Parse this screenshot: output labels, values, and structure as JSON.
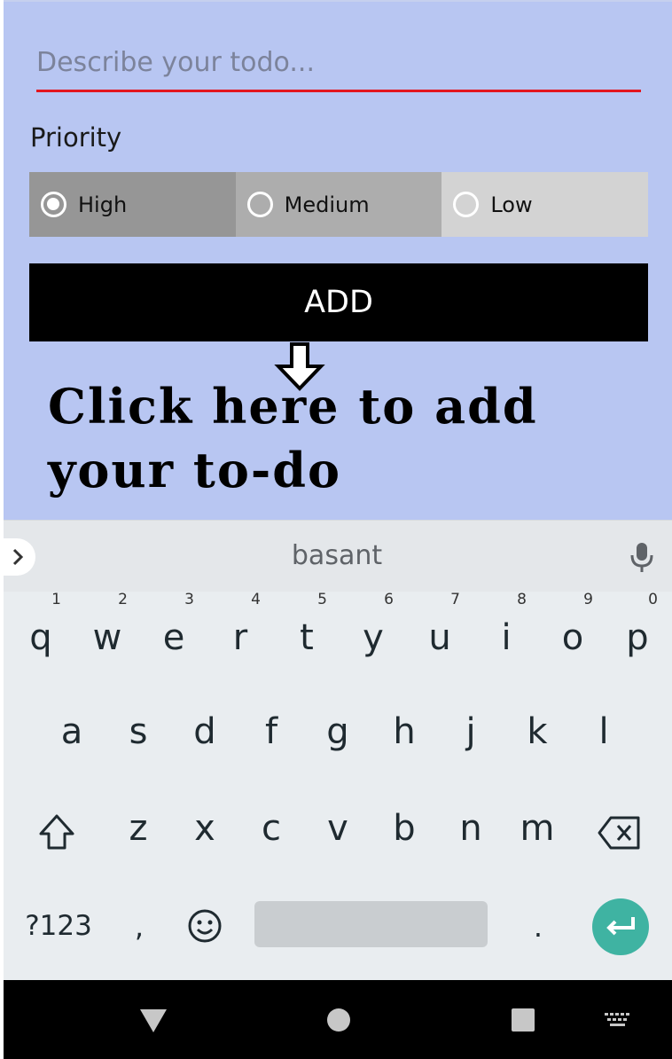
{
  "form": {
    "placeholder": "Describe your todo...",
    "priority_label": "Priority",
    "options": [
      {
        "label": "High",
        "checked": true
      },
      {
        "label": "Medium",
        "checked": false
      },
      {
        "label": "Low",
        "checked": false
      }
    ],
    "add_label": "ADD"
  },
  "hint": {
    "text": "Click here to add your to-do"
  },
  "keyboard": {
    "suggestion": "basant",
    "row1": [
      "q",
      "w",
      "e",
      "r",
      "t",
      "y",
      "u",
      "i",
      "o",
      "p"
    ],
    "row1_hints": [
      "1",
      "2",
      "3",
      "4",
      "5",
      "6",
      "7",
      "8",
      "9",
      "0"
    ],
    "row2": [
      "a",
      "s",
      "d",
      "f",
      "g",
      "h",
      "j",
      "k",
      "l"
    ],
    "row3": [
      "z",
      "x",
      "c",
      "v",
      "b",
      "n",
      "m"
    ],
    "symbols_label": "?123",
    "comma": ",",
    "period": "."
  },
  "colors": {
    "app_background": "#b8c6f2",
    "input_underline": "#e3161f",
    "enter_key": "#3fb3a2"
  },
  "icons": [
    "chevron-right-icon",
    "mic-icon",
    "shift-icon",
    "backspace-icon",
    "emoji-icon",
    "enter-icon",
    "back-icon",
    "home-icon",
    "recents-icon",
    "keyboard-switch-icon"
  ]
}
